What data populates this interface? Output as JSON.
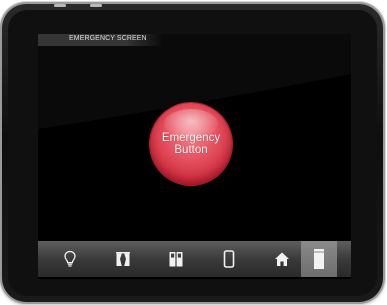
{
  "screen": {
    "title": "EMERGENCY SCREEN"
  },
  "emergency_button": {
    "line1": "Emergency",
    "line2": "Button",
    "color": "#e24a5a"
  },
  "bottom_nav": {
    "items": [
      {
        "name": "lightbulb",
        "icon": "lightbulb-icon",
        "active": false
      },
      {
        "name": "curtains",
        "icon": "curtains-icon",
        "active": false
      },
      {
        "name": "door",
        "icon": "door-icon",
        "active": false
      },
      {
        "name": "device",
        "icon": "phone-icon",
        "active": false
      },
      {
        "name": "home",
        "icon": "home-icon",
        "active": false
      },
      {
        "name": "emergency",
        "icon": "panel-icon",
        "active": true
      }
    ]
  }
}
